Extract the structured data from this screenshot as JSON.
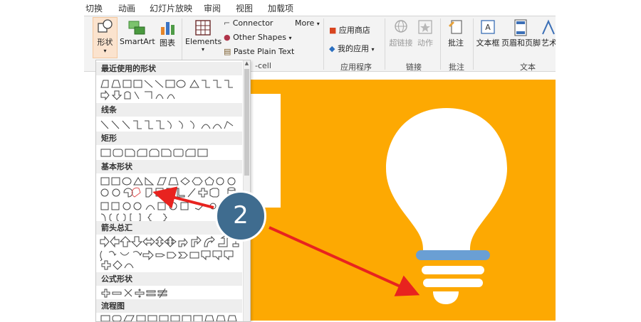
{
  "tabs": [
    "切换",
    "动画",
    "幻灯片放映",
    "审阅",
    "视图",
    "加载项"
  ],
  "ribbon": {
    "shapes_label": "形状",
    "smartart_label": "SmartArt",
    "chart_label": "图表",
    "elements_label": "Elements",
    "connector_label": "Connector",
    "other_shapes_label": "Other Shapes",
    "paste_plain_label": "Paste Plain Text",
    "more_label": "More",
    "cell_group_label": "-cell",
    "store_label": "应用商店",
    "my_apps_label": "我的应用",
    "apps_group_label": "应用程序",
    "hyperlink_label": "超链接",
    "action_label": "动作",
    "links_group_label": "链接",
    "comment_label": "批注",
    "comments_group_label": "批注",
    "textbox_label": "文本框",
    "header_footer_label": "页眉和页脚",
    "wordart_label": "艺术",
    "text_group_label": "文本"
  },
  "gallery": {
    "sections": [
      "最近使用的形状",
      "线条",
      "矩形",
      "基本形状",
      "箭头总汇",
      "公式形状",
      "流程图"
    ]
  },
  "annotation": {
    "step_number": "2"
  },
  "colors": {
    "slide_orange": "#fda902",
    "bulb_band_blue": "#6a9fd4",
    "marker_blue": "#3f6c8f",
    "arrow_red": "#e8231f"
  }
}
